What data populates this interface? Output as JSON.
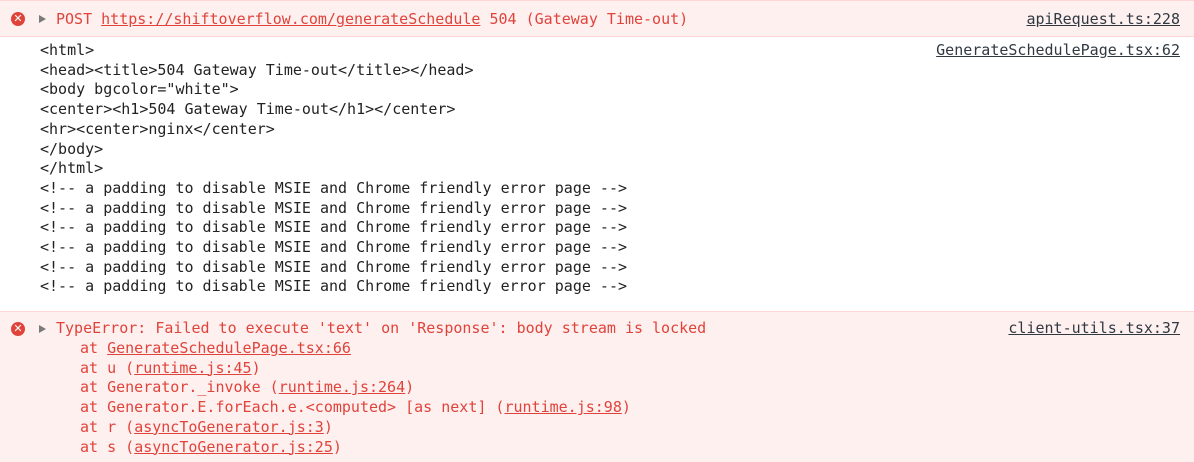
{
  "request_error": {
    "method": "POST",
    "url": "https://shiftoverflow.com/generateSchedule",
    "status": "504 (Gateway Time-out)",
    "source": "apiRequest.ts:228"
  },
  "log": {
    "source": "GenerateSchedulePage.tsx:62",
    "lines": [
      "<html>",
      "<head><title>504 Gateway Time-out</title></head>",
      "<body bgcolor=\"white\">",
      "<center><h1>504 Gateway Time-out</h1></center>",
      "<hr><center>nginx</center>",
      "</body>",
      "</html>",
      "<!-- a padding to disable MSIE and Chrome friendly error page -->",
      "<!-- a padding to disable MSIE and Chrome friendly error page -->",
      "<!-- a padding to disable MSIE and Chrome friendly error page -->",
      "<!-- a padding to disable MSIE and Chrome friendly error page -->",
      "<!-- a padding to disable MSIE and Chrome friendly error page -->",
      "<!-- a padding to disable MSIE and Chrome friendly error page -->"
    ]
  },
  "type_error": {
    "message": "TypeError: Failed to execute 'text' on 'Response': body stream is locked",
    "source": "client-utils.tsx:37",
    "stack": [
      {
        "prefix": "at ",
        "link": "GenerateSchedulePage.tsx:66",
        "suffix": ""
      },
      {
        "prefix": "at u (",
        "link": "runtime.js:45",
        "suffix": ")"
      },
      {
        "prefix": "at Generator._invoke (",
        "link": "runtime.js:264",
        "suffix": ")"
      },
      {
        "prefix": "at Generator.E.forEach.e.<computed> [as next] (",
        "link": "runtime.js:98",
        "suffix": ")"
      },
      {
        "prefix": "at r (",
        "link": "asyncToGenerator.js:3",
        "suffix": ")"
      },
      {
        "prefix": "at s (",
        "link": "asyncToGenerator.js:25",
        "suffix": ")"
      }
    ]
  },
  "icons": {
    "error": "error-circle-icon",
    "expand": "expand-triangle-icon"
  },
  "colors": {
    "error_text": "#e0433a",
    "error_bg": "#fff0f0",
    "error_border": "#ffd6d6",
    "text": "#222222",
    "link": "#303942"
  }
}
